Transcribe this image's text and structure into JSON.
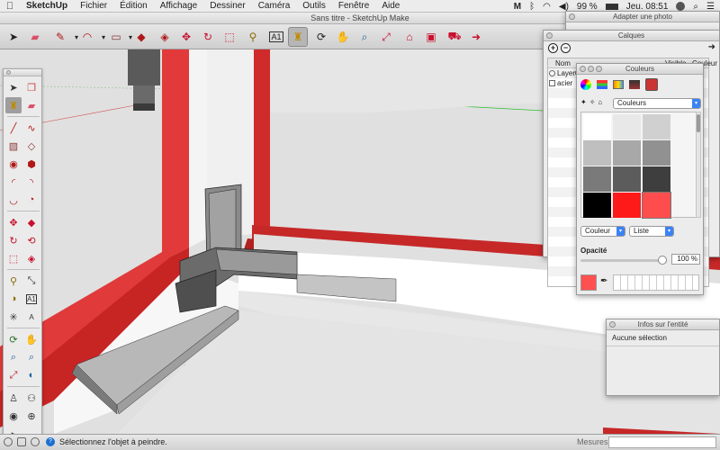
{
  "menubar": {
    "app": "SketchUp",
    "items": [
      "Fichier",
      "Édition",
      "Affichage",
      "Dessiner",
      "Caméra",
      "Outils",
      "Fenêtre",
      "Aide"
    ],
    "battery": "99 %",
    "clock": "Jeu. 08:51"
  },
  "window": {
    "title": "Sans titre - SketchUp Make"
  },
  "toolbar": {
    "tools": [
      {
        "name": "select-tool-icon",
        "glyph": "➤"
      },
      {
        "name": "eraser-tool-icon",
        "glyph": "▰"
      },
      {
        "name": "pencil-tool-icon",
        "glyph": "✎"
      },
      {
        "name": "arc-tool-icon",
        "glyph": "◠"
      },
      {
        "name": "rectangle-tool-icon",
        "glyph": "▭"
      },
      {
        "name": "push-pull-tool-icon",
        "glyph": "◆"
      },
      {
        "name": "offset-tool-icon",
        "glyph": "◈"
      },
      {
        "name": "move-tool-icon",
        "glyph": "✥"
      },
      {
        "name": "rotate-tool-icon",
        "glyph": "↻"
      },
      {
        "name": "scale-tool-icon",
        "glyph": "⬚"
      },
      {
        "name": "tape-measure-tool-icon",
        "glyph": "⚲"
      },
      {
        "name": "text-tool-icon",
        "glyph": "A"
      },
      {
        "name": "paint-bucket-tool-icon",
        "glyph": "🪣"
      },
      {
        "name": "orbit-tool-icon",
        "glyph": "⟳"
      },
      {
        "name": "pan-tool-icon",
        "glyph": "✋"
      },
      {
        "name": "zoom-tool-icon",
        "glyph": "⌕"
      },
      {
        "name": "zoom-extents-tool-icon",
        "glyph": "⤢"
      },
      {
        "name": "warehouse-icon",
        "glyph": "⌂"
      },
      {
        "name": "extension-warehouse-icon",
        "glyph": "▣"
      },
      {
        "name": "share-model-icon",
        "glyph": "➜"
      }
    ]
  },
  "panels": {
    "adjust_photo": {
      "title": "Adapter une photo"
    },
    "layers": {
      "title": "Calques",
      "columns": [
        "Nom",
        "Visible",
        "Couleur"
      ],
      "rows": [
        "Layer0",
        "acier"
      ]
    },
    "colors": {
      "title": "Couleurs",
      "palette_select": "Couleurs",
      "mode_select_1": "Couleur",
      "mode_select_2": "Liste",
      "opacity_label": "Opacité",
      "opacity_value": "100 %",
      "opacity_fraction": 1.0,
      "swatches": [
        "#ffffff",
        "#e8e8e8",
        "#d0d0d0",
        "#bfbfbf",
        "#a8a8a8",
        "#919191",
        "#7a7a7a",
        "#5c5c5c",
        "#3e3e3e",
        "#000000",
        "#ff1a1a",
        "#ff4d4d"
      ],
      "current_color": "#ff5050"
    },
    "entity_info": {
      "title": "Infos sur l'entité",
      "content": "Aucune sélection"
    }
  },
  "status": {
    "message": "Sélectionnez l'objet à peindre.",
    "measures_label": "Mesures"
  }
}
